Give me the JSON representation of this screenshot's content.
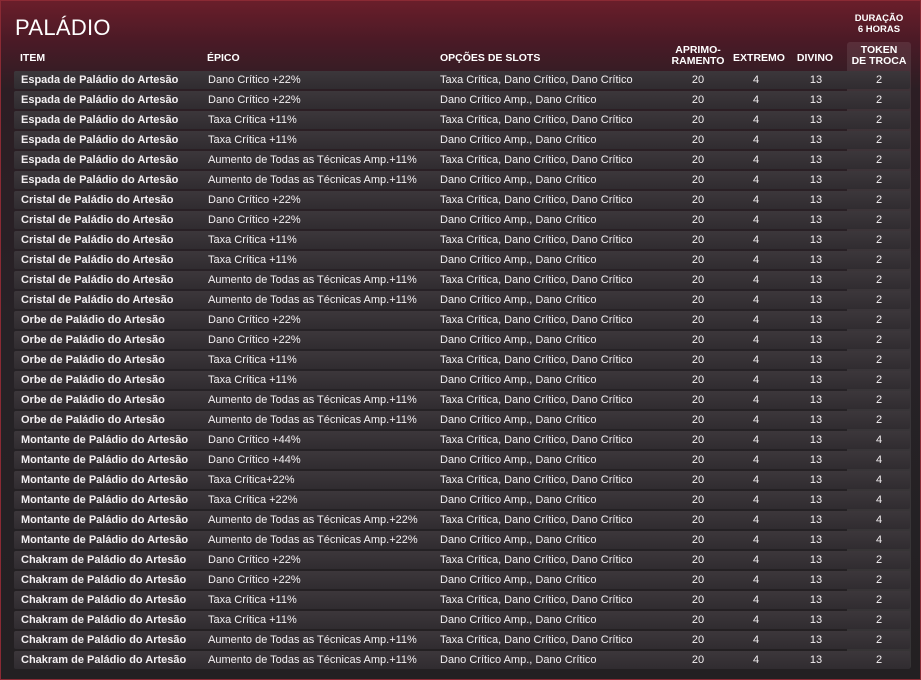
{
  "title": "PALÁDIO",
  "duration": {
    "line1": "DURAÇÃO",
    "line2": "6 HORAS"
  },
  "headers": {
    "item": "ITEM",
    "epic": "ÉPICO",
    "slots": "OPÇÕES DE SLOTS",
    "aprim1": "APRIMO-",
    "aprim2": "RAMENTO",
    "extreme": "EXTREMO",
    "divine": "DIVINO",
    "token1": "TOKEN",
    "token2": "DE TROCA"
  },
  "rows": [
    {
      "item": "Espada de Paládio do Artesão",
      "epic": "Dano Crítico +22%",
      "slots": "Taxa Crítica, Dano Crítico, Dano Crítico",
      "aprim": "20",
      "extreme": "4",
      "divine": "13",
      "token": "2"
    },
    {
      "item": "Espada de Paládio do Artesão",
      "epic": "Dano Crítico +22%",
      "slots": "Dano Crítico Amp., Dano Crítico",
      "aprim": "20",
      "extreme": "4",
      "divine": "13",
      "token": "2"
    },
    {
      "item": "Espada de Paládio do Artesão",
      "epic": "Taxa Crítica +11%",
      "slots": "Taxa Crítica, Dano Crítico, Dano Crítico",
      "aprim": "20",
      "extreme": "4",
      "divine": "13",
      "token": "2"
    },
    {
      "item": "Espada de Paládio do Artesão",
      "epic": "Taxa Crítica +11%",
      "slots": "Dano Crítico Amp., Dano Crítico",
      "aprim": "20",
      "extreme": "4",
      "divine": "13",
      "token": "2"
    },
    {
      "item": "Espada de Paládio do Artesão",
      "epic": "Aumento de Todas as Técnicas Amp.+11%",
      "slots": "Taxa Crítica, Dano Crítico, Dano Crítico",
      "aprim": "20",
      "extreme": "4",
      "divine": "13",
      "token": "2"
    },
    {
      "item": "Espada de Paládio do Artesão",
      "epic": "Aumento de Todas as Técnicas Amp.+11%",
      "slots": "Dano Crítico Amp., Dano Crítico",
      "aprim": "20",
      "extreme": "4",
      "divine": "13",
      "token": "2"
    },
    {
      "item": "Cristal de Paládio do Artesão",
      "epic": "Dano Crítico +22%",
      "slots": "Taxa Crítica, Dano Crítico, Dano Crítico",
      "aprim": "20",
      "extreme": "4",
      "divine": "13",
      "token": "2"
    },
    {
      "item": "Cristal de Paládio do Artesão",
      "epic": "Dano Crítico +22%",
      "slots": "Dano Crítico Amp., Dano Crítico",
      "aprim": "20",
      "extreme": "4",
      "divine": "13",
      "token": "2"
    },
    {
      "item": "Cristal de Paládio do Artesão",
      "epic": "Taxa Crítica  +11%",
      "slots": "Taxa Crítica, Dano Crítico, Dano Crítico",
      "aprim": "20",
      "extreme": "4",
      "divine": "13",
      "token": "2"
    },
    {
      "item": "Cristal de Paládio do Artesão",
      "epic": "Taxa Crítica  +11%",
      "slots": "Dano Crítico Amp., Dano Crítico",
      "aprim": "20",
      "extreme": "4",
      "divine": "13",
      "token": "2"
    },
    {
      "item": "Cristal de Paládio do Artesão",
      "epic": "Aumento de Todas as Técnicas Amp.+11%",
      "slots": "Taxa Crítica, Dano Crítico, Dano Crítico",
      "aprim": "20",
      "extreme": "4",
      "divine": "13",
      "token": "2"
    },
    {
      "item": "Cristal de Paládio do Artesão",
      "epic": "Aumento de Todas as Técnicas Amp.+11%",
      "slots": "Dano Crítico Amp., Dano Crítico",
      "aprim": "20",
      "extreme": "4",
      "divine": "13",
      "token": "2"
    },
    {
      "item": "Orbe de Paládio do Artesão",
      "epic": "Dano Crítico +22%",
      "slots": "Taxa Crítica, Dano Crítico, Dano Crítico",
      "aprim": "20",
      "extreme": "4",
      "divine": "13",
      "token": "2"
    },
    {
      "item": "Orbe de Paládio do Artesão",
      "epic": "Dano Crítico +22%",
      "slots": "Dano Crítico Amp., Dano Crítico",
      "aprim": "20",
      "extreme": "4",
      "divine": "13",
      "token": "2"
    },
    {
      "item": "Orbe de Paládio do Artesão",
      "epic": "Taxa Crítica  +11%",
      "slots": "Taxa Crítica, Dano Crítico, Dano Crítico",
      "aprim": "20",
      "extreme": "4",
      "divine": "13",
      "token": "2"
    },
    {
      "item": "Orbe de Paládio do Artesão",
      "epic": "Taxa Crítica  +11%",
      "slots": "Dano Crítico Amp., Dano Crítico",
      "aprim": "20",
      "extreme": "4",
      "divine": "13",
      "token": "2"
    },
    {
      "item": "Orbe de Paládio do Artesão",
      "epic": "Aumento de Todas as Técnicas Amp.+11%",
      "slots": "Taxa Crítica, Dano Crítico, Dano Crítico",
      "aprim": "20",
      "extreme": "4",
      "divine": "13",
      "token": "2"
    },
    {
      "item": "Orbe de Paládio do Artesão",
      "epic": "Aumento de Todas as Técnicas Amp.+11%",
      "slots": "Dano Crítico Amp., Dano Crítico",
      "aprim": "20",
      "extreme": "4",
      "divine": "13",
      "token": "2"
    },
    {
      "item": "Montante de Paládio do Artesão",
      "epic": "Dano Crítico +44%",
      "slots": "Taxa Crítica, Dano Crítico, Dano Crítico",
      "aprim": "20",
      "extreme": "4",
      "divine": "13",
      "token": "4"
    },
    {
      "item": "Montante de Paládio do Artesão",
      "epic": "Dano Crítico +44%",
      "slots": "Dano Crítico Amp., Dano Crítico",
      "aprim": "20",
      "extreme": "4",
      "divine": "13",
      "token": "4"
    },
    {
      "item": "Montante de Paládio do Artesão",
      "epic": "Taxa Crítica+22%",
      "slots": "Taxa Crítica, Dano Crítico, Dano Crítico",
      "aprim": "20",
      "extreme": "4",
      "divine": "13",
      "token": "4"
    },
    {
      "item": "Montante de Paládio do Artesão",
      "epic": "Taxa Crítica +22%",
      "slots": "Dano Crítico Amp., Dano Crítico",
      "aprim": "20",
      "extreme": "4",
      "divine": "13",
      "token": "4"
    },
    {
      "item": "Montante de Paládio do Artesão",
      "epic": "Aumento de Todas as Técnicas Amp.+22%",
      "slots": "Taxa Crítica, Dano Crítico, Dano Crítico",
      "aprim": "20",
      "extreme": "4",
      "divine": "13",
      "token": "4"
    },
    {
      "item": "Montante de Paládio do Artesão",
      "epic": "Aumento de Todas as Técnicas Amp.+22%",
      "slots": "Dano Crítico Amp., Dano Crítico",
      "aprim": "20",
      "extreme": "4",
      "divine": "13",
      "token": "4"
    },
    {
      "item": "Chakram de Paládio do Artesão",
      "epic": "Dano Crítico +22%",
      "slots": "Taxa Crítica, Dano Crítico, Dano Crítico",
      "aprim": "20",
      "extreme": "4",
      "divine": "13",
      "token": "2"
    },
    {
      "item": "Chakram de Paládio do Artesão",
      "epic": "Dano Crítico +22%",
      "slots": "Dano Crítico Amp., Dano Crítico",
      "aprim": "20",
      "extreme": "4",
      "divine": "13",
      "token": "2"
    },
    {
      "item": "Chakram de Paládio do Artesão",
      "epic": "Taxa Crítica +11%",
      "slots": "Taxa Crítica, Dano Crítico, Dano Crítico",
      "aprim": "20",
      "extreme": "4",
      "divine": "13",
      "token": "2"
    },
    {
      "item": "Chakram de Paládio do Artesão",
      "epic": "Taxa Crítica +11%",
      "slots": "Dano Crítico Amp., Dano Crítico",
      "aprim": "20",
      "extreme": "4",
      "divine": "13",
      "token": "2"
    },
    {
      "item": "Chakram de Paládio do Artesão",
      "epic": "Aumento de Todas as Técnicas Amp.+11%",
      "slots": "Taxa Crítica, Dano Crítico, Dano Crítico",
      "aprim": "20",
      "extreme": "4",
      "divine": "13",
      "token": "2"
    },
    {
      "item": "Chakram de Paládio do Artesão",
      "epic": "Aumento de Todas as Técnicas Amp.+11%",
      "slots": "Dano Crítico Amp., Dano Crítico",
      "aprim": "20",
      "extreme": "4",
      "divine": "13",
      "token": "2"
    }
  ]
}
